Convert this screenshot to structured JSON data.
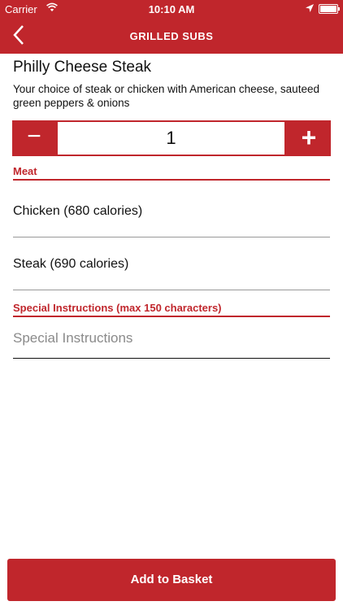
{
  "status_bar": {
    "carrier": "Carrier",
    "time": "10:10 AM"
  },
  "nav": {
    "title": "GRILLED SUBS"
  },
  "item": {
    "name": "Philly Cheese Steak",
    "description": "Your choice of steak or chicken with American cheese, sauteed green peppers & onions"
  },
  "stepper": {
    "minus": "−",
    "quantity": "1",
    "plus": "+"
  },
  "meat": {
    "label": "Meat",
    "options": [
      "Chicken (680 calories)",
      "Steak (690 calories)"
    ]
  },
  "special": {
    "label": "Special Instructions (max 150 characters)",
    "placeholder": "Special Instructions"
  },
  "actions": {
    "add_to_basket": "Add to Basket"
  },
  "colors": {
    "brand": "#c0262c"
  }
}
